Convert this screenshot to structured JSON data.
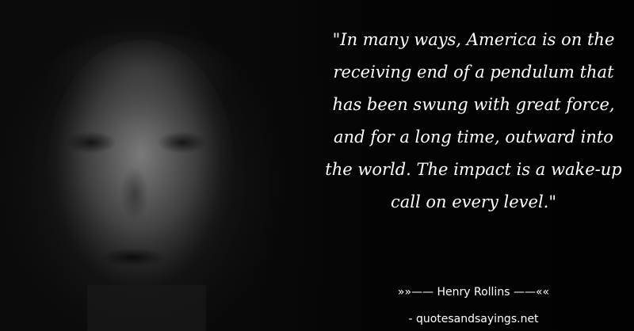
{
  "quote": {
    "text": "\"In many ways, America is on the receiving end of a pendulum that has been swung with great force, and for a long time, outward into the world. The impact is a wake-up call on every level.\""
  },
  "author": {
    "line": "»»—— Henry Rollins ——««"
  },
  "site": {
    "line": "- quotesandsayings.net"
  },
  "colors": {
    "background": "#050505",
    "text": "#ffffff"
  }
}
